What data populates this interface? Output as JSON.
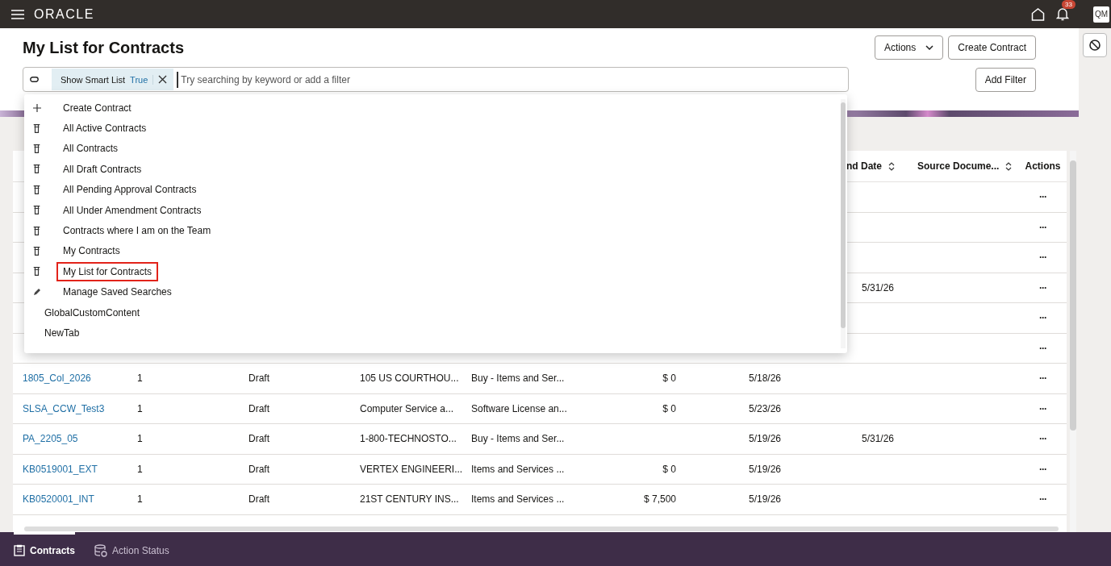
{
  "top_bar": {
    "brand": "ORACLE",
    "notification_count": "33",
    "avatar": "QM"
  },
  "page": {
    "title": "My List for Contracts",
    "actions_button": "Actions",
    "create_button": "Create Contract",
    "add_filter_button": "Add Filter"
  },
  "search": {
    "chip_label": "Show Smart List",
    "chip_value": "True",
    "placeholder": "Try searching by keyword or add a filter"
  },
  "saved_searches": [
    {
      "label": "Create Contract",
      "kind": "create",
      "highlighted": false
    },
    {
      "label": "All Active Contracts",
      "kind": "saved",
      "highlighted": false
    },
    {
      "label": "All Contracts",
      "kind": "saved",
      "highlighted": false
    },
    {
      "label": "All Draft Contracts",
      "kind": "saved",
      "highlighted": false
    },
    {
      "label": "All Pending Approval Contracts",
      "kind": "saved",
      "highlighted": false
    },
    {
      "label": "All Under Amendment Contracts",
      "kind": "saved",
      "highlighted": false
    },
    {
      "label": "Contracts where I am on the Team",
      "kind": "saved",
      "highlighted": false
    },
    {
      "label": "My Contracts",
      "kind": "saved",
      "highlighted": false
    },
    {
      "label": "My List for Contracts",
      "kind": "saved",
      "highlighted": true
    },
    {
      "label": "Manage Saved Searches",
      "kind": "manage",
      "highlighted": false
    },
    {
      "label": "GlobalCustomContent",
      "kind": "tab",
      "highlighted": false
    },
    {
      "label": "NewTab",
      "kind": "tab",
      "highlighted": false
    }
  ],
  "table": {
    "columns": [
      null,
      null,
      null,
      null,
      null,
      null,
      null,
      {
        "label": "nd Date",
        "sortable": true
      },
      {
        "label": "Source Docume...",
        "sortable": true
      },
      {
        "label": "Actions",
        "sortable": false
      }
    ],
    "rows": [
      {
        "cells": [
          null,
          null,
          null,
          null,
          null,
          null,
          null,
          null,
          null,
          "···"
        ]
      },
      {
        "cells": [
          null,
          null,
          null,
          null,
          null,
          null,
          null,
          null,
          null,
          "···"
        ]
      },
      {
        "cells": [
          null,
          null,
          null,
          null,
          null,
          null,
          null,
          null,
          null,
          "···"
        ]
      },
      {
        "cells": [
          null,
          null,
          null,
          null,
          null,
          null,
          null,
          "5/31/26",
          null,
          "···"
        ]
      },
      {
        "cells": [
          null,
          null,
          null,
          null,
          null,
          null,
          null,
          null,
          null,
          "···"
        ]
      },
      {
        "cells": [
          null,
          null,
          null,
          null,
          null,
          null,
          null,
          null,
          null,
          "···"
        ]
      },
      {
        "cells": [
          "1805_Col_2026",
          "1",
          "Draft",
          "105 US COURTHOU...",
          "Buy - Items and Ser...",
          "$ 0",
          "5/18/26",
          null,
          null,
          "···"
        ]
      },
      {
        "cells": [
          "SLSA_CCW_Test3",
          "1",
          "Draft",
          "Computer Service a...",
          "Software License an...",
          "$ 0",
          "5/23/26",
          null,
          null,
          "···"
        ]
      },
      {
        "cells": [
          "PA_2205_05",
          "1",
          "Draft",
          "1-800-TECHNOSTO...",
          "Buy - Items and Ser...",
          null,
          "5/19/26",
          "5/31/26",
          null,
          "···"
        ]
      },
      {
        "cells": [
          "KB0519001_EXT",
          "1",
          "Draft",
          "VERTEX ENGINEERI...",
          "Items and Services ...",
          "$ 0",
          "5/19/26",
          null,
          null,
          "···"
        ]
      },
      {
        "cells": [
          "KB0520001_INT",
          "1",
          "Draft",
          "21ST CENTURY INS...",
          "Items and Services ...",
          "$ 7,500",
          "5/19/26",
          null,
          null,
          "···"
        ]
      }
    ]
  },
  "bottom_tabs": [
    {
      "label": "Contracts",
      "kind": "contracts",
      "selected": true
    },
    {
      "label": "Action Status",
      "kind": "status",
      "selected": false
    }
  ]
}
